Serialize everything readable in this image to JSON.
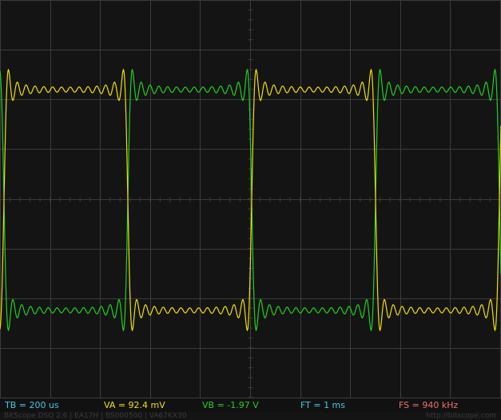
{
  "colors": {
    "background": "#141414",
    "grid": "#3c3c3c",
    "trace_a": "#f0e000",
    "trace_b": "#20d020",
    "tb_text": "#40c8e0",
    "va_text": "#f0e000",
    "vb_text": "#20d020",
    "ft_text": "#40c8e0",
    "fs_text": "#f07070"
  },
  "status": {
    "tb": "TB = 200 us",
    "va": "VA = 92.4 mV",
    "vb": "VB = -1.97 V",
    "ft": "FT = 1 ms",
    "fs": "FS = 940 kHz"
  },
  "footer": {
    "left": "BitScope DSO 2.6 | EA17H | BS000500 | VA67KX30",
    "right": "http://bitscope.com"
  },
  "traces": {
    "a": {
      "color_key": "trace_a"
    },
    "b": {
      "color_key": "trace_b"
    }
  }
}
